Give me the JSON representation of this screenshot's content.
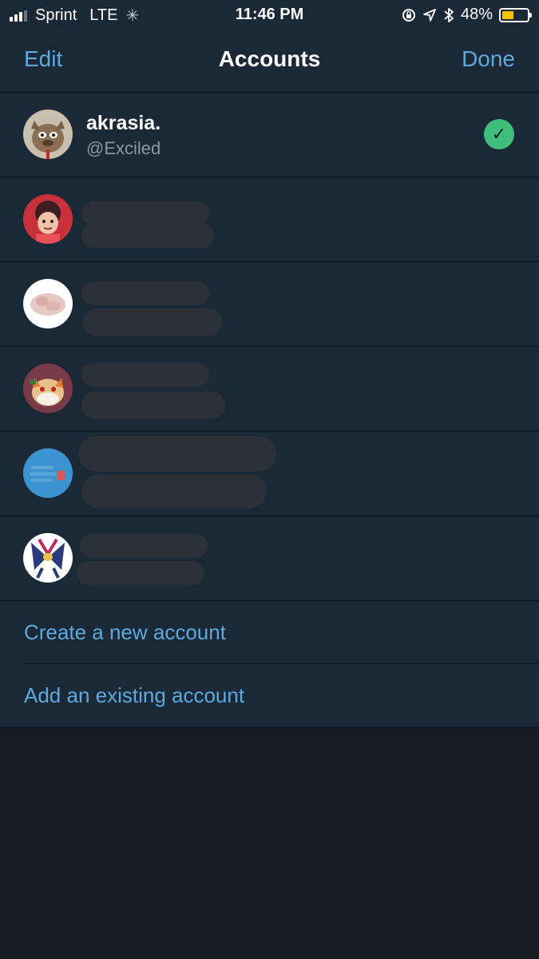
{
  "status_bar": {
    "carrier": "Sprint",
    "network": "LTE",
    "time": "11:46 PM",
    "battery_percent": "48%",
    "battery_level": 0.48,
    "battery_color": "#f5c400"
  },
  "nav": {
    "edit_label": "Edit",
    "title": "Accounts",
    "done_label": "Done"
  },
  "accounts": [
    {
      "name": "akrasia.",
      "handle": "@Exciled",
      "selected": true
    },
    {
      "name": "",
      "handle": "",
      "selected": false
    },
    {
      "name": "",
      "handle": "",
      "selected": false
    },
    {
      "name": "",
      "handle": "",
      "selected": false
    },
    {
      "name": "",
      "handle": "",
      "selected": false
    },
    {
      "name": "",
      "handle": "",
      "selected": false
    }
  ],
  "actions": {
    "create_label": "Create a new account",
    "add_label": "Add an existing account"
  },
  "colors": {
    "accent": "#5ea9dd",
    "check": "#3fbd7a",
    "panel": "#1b2836",
    "background": "#141c26"
  }
}
